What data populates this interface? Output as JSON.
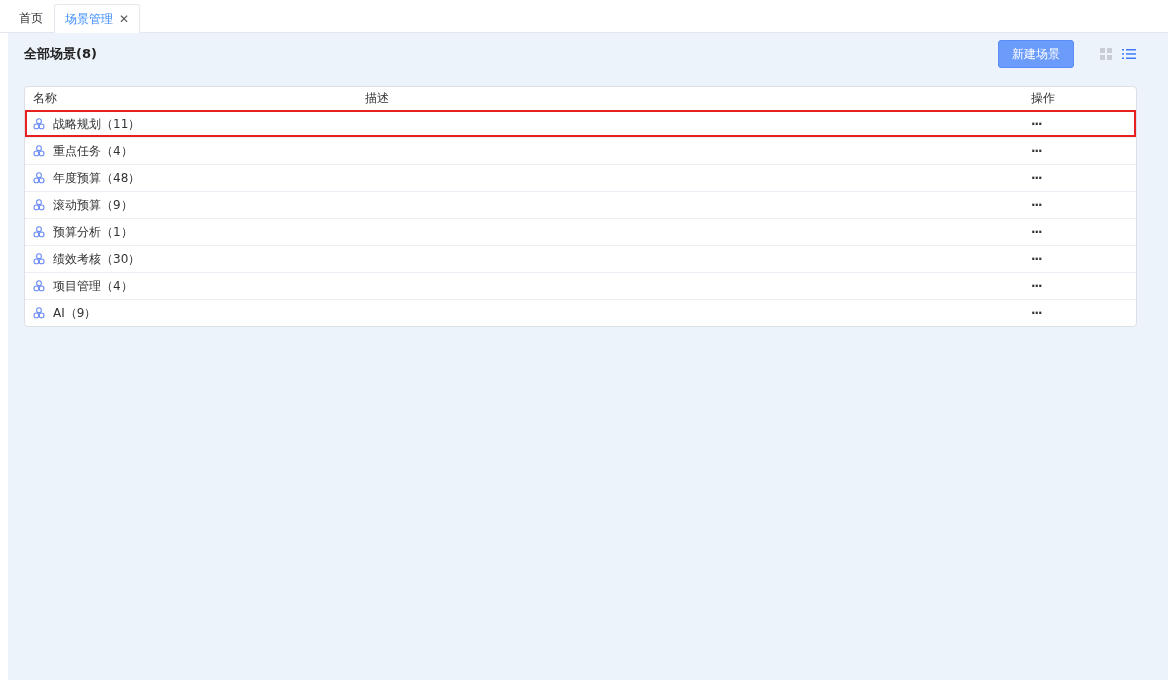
{
  "tabs": [
    {
      "label": "首页",
      "selected": false,
      "closable": false
    },
    {
      "label": "场景管理",
      "selected": true,
      "closable": true,
      "close_glyph": "✕"
    }
  ],
  "heading": "全部场景(8)",
  "new_button": "新建场景",
  "view_modes": [
    {
      "kind": "grid",
      "selected": false
    },
    {
      "kind": "list",
      "selected": true
    }
  ],
  "table": {
    "columns": [
      "名称",
      "描述",
      "操作"
    ],
    "rows": [
      {
        "name": "战略规划（11）",
        "action": "···",
        "highlighted": true
      },
      {
        "name": "重点任务（4）",
        "action": "···",
        "highlighted": false
      },
      {
        "name": "年度预算（48）",
        "action": "···",
        "highlighted": false
      },
      {
        "name": "滚动预算（9）",
        "action": "···",
        "highlighted": false
      },
      {
        "name": "预算分析（1）",
        "action": "···",
        "highlighted": false
      },
      {
        "name": "绩效考核（30）",
        "action": "···",
        "highlighted": false
      },
      {
        "name": "项目管理（4）",
        "action": "···",
        "highlighted": false
      },
      {
        "name": "AI（9）",
        "action": "···",
        "highlighted": false
      }
    ]
  }
}
